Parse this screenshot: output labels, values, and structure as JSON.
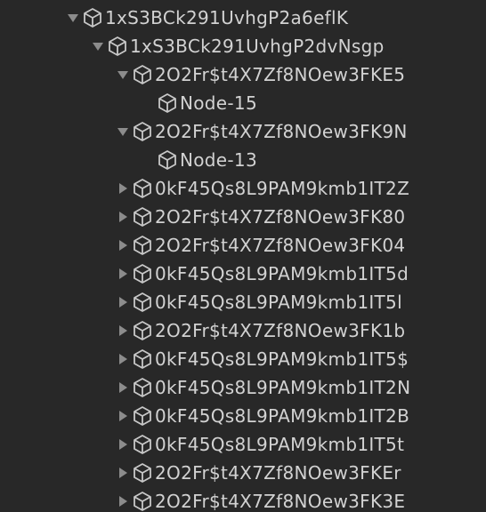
{
  "colors": {
    "background": "#282828",
    "text": "#d2d2d2",
    "icon": "#c8c8c8",
    "arrow": "#8c8c8c"
  },
  "icons": {
    "node": "cube-icon",
    "expanded": "triangle-down-icon",
    "collapsed": "triangle-right-icon"
  },
  "tree": {
    "rows": [
      {
        "label": "1xS3BCk291UvhgP2a6eflK",
        "depth": 0,
        "state": "expanded"
      },
      {
        "label": "1xS3BCk291UvhgP2dvNsgp",
        "depth": 1,
        "state": "expanded"
      },
      {
        "label": "2O2Fr$t4X7Zf8NOew3FKE5",
        "depth": 2,
        "state": "expanded"
      },
      {
        "label": "Node-15",
        "depth": 3,
        "state": "leaf"
      },
      {
        "label": "2O2Fr$t4X7Zf8NOew3FK9N",
        "depth": 2,
        "state": "expanded"
      },
      {
        "label": "Node-13",
        "depth": 3,
        "state": "leaf"
      },
      {
        "label": "0kF45Qs8L9PAM9kmb1IT2Z",
        "depth": 2,
        "state": "collapsed"
      },
      {
        "label": "2O2Fr$t4X7Zf8NOew3FK80",
        "depth": 2,
        "state": "collapsed"
      },
      {
        "label": "2O2Fr$t4X7Zf8NOew3FK04",
        "depth": 2,
        "state": "collapsed"
      },
      {
        "label": "0kF45Qs8L9PAM9kmb1IT5d",
        "depth": 2,
        "state": "collapsed"
      },
      {
        "label": "0kF45Qs8L9PAM9kmb1IT5l",
        "depth": 2,
        "state": "collapsed"
      },
      {
        "label": "2O2Fr$t4X7Zf8NOew3FK1b",
        "depth": 2,
        "state": "collapsed"
      },
      {
        "label": "0kF45Qs8L9PAM9kmb1IT5$",
        "depth": 2,
        "state": "collapsed"
      },
      {
        "label": "0kF45Qs8L9PAM9kmb1IT2N",
        "depth": 2,
        "state": "collapsed"
      },
      {
        "label": "0kF45Qs8L9PAM9kmb1IT2B",
        "depth": 2,
        "state": "collapsed"
      },
      {
        "label": "0kF45Qs8L9PAM9kmb1IT5t",
        "depth": 2,
        "state": "collapsed"
      },
      {
        "label": "2O2Fr$t4X7Zf8NOew3FKEr",
        "depth": 2,
        "state": "collapsed"
      },
      {
        "label": "2O2Fr$t4X7Zf8NOew3FK3E",
        "depth": 2,
        "state": "collapsed"
      }
    ]
  }
}
